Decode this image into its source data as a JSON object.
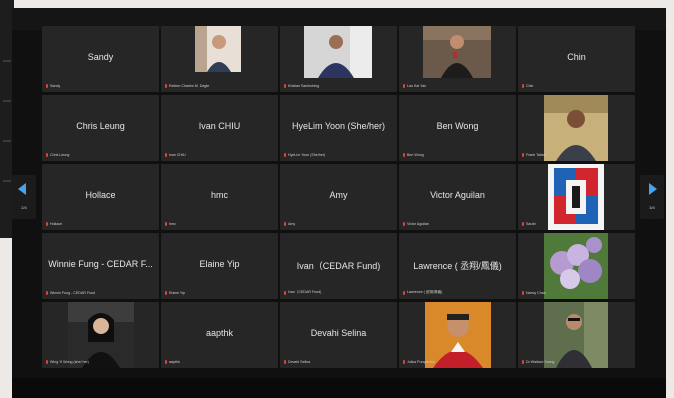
{
  "colors": {
    "accent": "#4aa3e8",
    "muted_mic": "#e0433a",
    "tile": "#262626",
    "background": "#101010"
  },
  "pager": {
    "left_page": "2/4",
    "right_page": "3/4"
  },
  "tiles": [
    {
      "big": "Sandy",
      "name": "Sandy",
      "video": false
    },
    {
      "big": "",
      "name": "Reldon Charles M. Dagle",
      "video": true
    },
    {
      "big": "",
      "name": "Kristian Sambohing",
      "video": true
    },
    {
      "big": "",
      "name": "Lau Kai Yan",
      "video": true
    },
    {
      "big": "Chin",
      "name": "Chin",
      "video": false
    },
    {
      "big": "Chris Leung",
      "name": "Chris Leung",
      "video": false
    },
    {
      "big": "Ivan CHIU",
      "name": "Ivan CHIU",
      "video": false
    },
    {
      "big": "HyeLim Yoon (She/her)",
      "name": "HyeLim Yoon (She/her)",
      "video": false
    },
    {
      "big": "Ben Wong",
      "name": "Ben Wong",
      "video": false
    },
    {
      "big": "",
      "name": "Frank Tatlan",
      "video": true
    },
    {
      "big": "Hollace",
      "name": "Hollace",
      "video": false
    },
    {
      "big": "hmc",
      "name": "hmc",
      "video": false
    },
    {
      "big": "Amy",
      "name": "Amy",
      "video": false
    },
    {
      "big": "Victor Aguilan",
      "name": "Victor Aguilan",
      "video": false
    },
    {
      "big": "",
      "name": "Sarah",
      "video": true
    },
    {
      "big": "Winnie Fung - CEDAR F...",
      "name": "Winnie Fung - CEDAR Fund",
      "video": false
    },
    {
      "big": "Elaine Yip",
      "name": "Elaine Yip",
      "video": false
    },
    {
      "big": "Ivan（CEDAR Fund)",
      "name": "Ivan（CEDAR Fund)",
      "video": false
    },
    {
      "big": "Lawrence ( 丞翔/鳳儀)",
      "name": "Lawrence ( 丞翔/鳳儀)",
      "video": false
    },
    {
      "big": "",
      "name": "Nancy Chan",
      "video": true
    },
    {
      "big": "",
      "name": "Wing Yi Wong (she/ her)",
      "video": true
    },
    {
      "big": "aapthk",
      "name": "aapthk",
      "video": false
    },
    {
      "big": "Devahi Selina",
      "name": "Devahi Selina",
      "video": false
    },
    {
      "big": "",
      "name": "Julius Purquerino",
      "video": true
    },
    {
      "big": "",
      "name": "Dr Wallace Young",
      "video": true
    }
  ]
}
